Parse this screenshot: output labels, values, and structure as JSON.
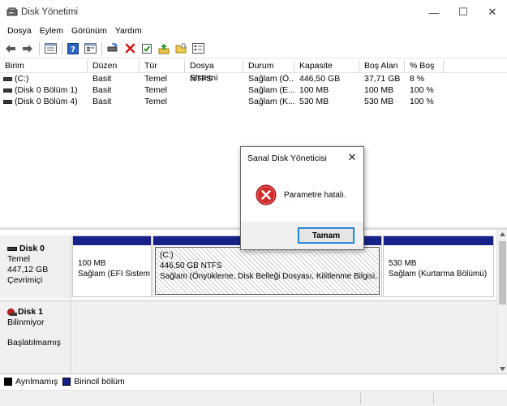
{
  "window": {
    "title": "Disk Yönetimi",
    "minimize_glyph": "—",
    "maximize_glyph": "☐",
    "close_glyph": "✕"
  },
  "menu": [
    "Dosya",
    "Eylem",
    "Görünüm",
    "Yardım"
  ],
  "toolbar": {
    "icons": [
      "back-arrow-icon",
      "forward-arrow-icon",
      "properties-view-icon",
      "help-icon",
      "list-view-icon",
      "connect-icon",
      "delete-icon",
      "check-icon",
      "move-up-icon",
      "open-folder-icon",
      "settings-list-icon"
    ]
  },
  "volume_table": {
    "headers": [
      "Birim",
      "Düzen",
      "Tür",
      "Dosya Sistemi",
      "Durum",
      "Kapasite",
      "Boş Alan",
      "% Boş"
    ],
    "rows": [
      [
        "(C:)",
        "Basit",
        "Temel",
        "NTFS",
        "Sağlam (Ö...",
        "446,50 GB",
        "37,71 GB",
        "8 %"
      ],
      [
        "(Disk 0 Bölüm 1)",
        "Basit",
        "Temel",
        "",
        "Sağlam (E...",
        "100 MB",
        "100 MB",
        "100 %"
      ],
      [
        "(Disk 0 Bölüm 4)",
        "Basit",
        "Temel",
        "",
        "Sağlam (K...",
        "530 MB",
        "530 MB",
        "100 %"
      ]
    ]
  },
  "disks": {
    "disk0": {
      "name": "Disk 0",
      "type": "Temel",
      "size": "447,12 GB",
      "status": "Çevrimiçi",
      "partitions": [
        {
          "size": "100 MB",
          "status": "Sağlam (EFI Sistem Bölümü)"
        },
        {
          "letter": "(C:)",
          "size": "446,50 GB NTFS",
          "status": "Sağlam (Önyükleme, Disk Belleği Dosyası, Kilitlenme Bilgisi, Temel Veri Bölümü)"
        },
        {
          "size": "530 MB",
          "status": "Sağlam (Kurtarma Bölümü)"
        }
      ]
    },
    "disk1": {
      "name": "Disk 1",
      "type": "Bilinmiyor",
      "status": "Başlatılmamış"
    }
  },
  "legend": {
    "unallocated": "Ayrılmamış",
    "primary": "Birincil bölüm",
    "unallocated_color": "#000000",
    "primary_color": "#18208a"
  },
  "dialog": {
    "title": "Sanal Disk Yöneticisi",
    "message": "Parametre hatalı.",
    "ok_label": "Tamam",
    "close_glyph": "✕"
  }
}
